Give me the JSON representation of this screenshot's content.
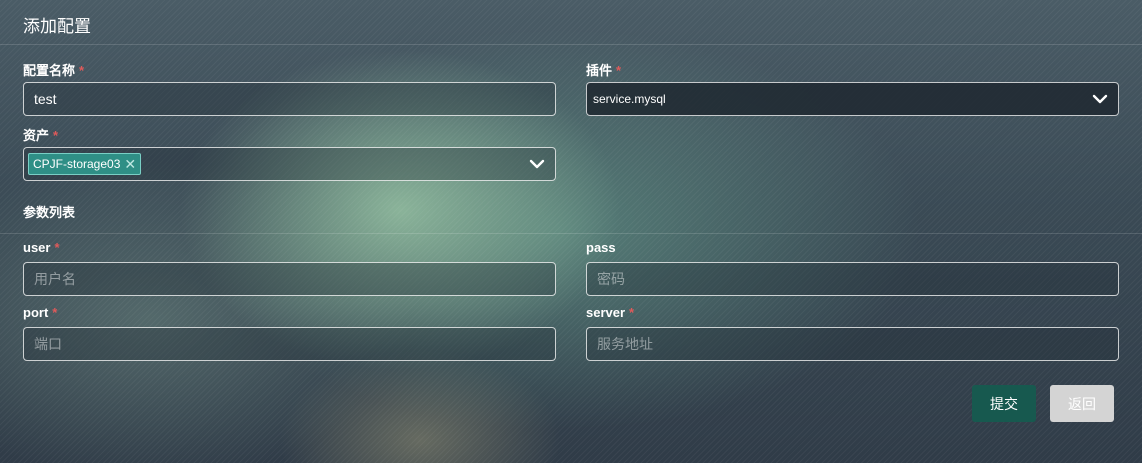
{
  "dialog": {
    "title": "添加配置"
  },
  "form": {
    "config_name": {
      "label": "配置名称",
      "required_mark": "*",
      "value": "test"
    },
    "plugin": {
      "label": "插件",
      "required_mark": "*",
      "selected": "service.mysql",
      "icon": "chevron-down-icon"
    },
    "asset": {
      "label": "资产",
      "required_mark": "*",
      "tags": [
        "CPJF-storage03"
      ],
      "tag_remove": "✕",
      "icon": "chevron-down-icon"
    }
  },
  "params": {
    "section_label": "参数列表",
    "user": {
      "label": "user",
      "required_mark": "*",
      "placeholder": "用户名"
    },
    "pass": {
      "label": "pass",
      "placeholder": "密码"
    },
    "port": {
      "label": "port",
      "required_mark": "*",
      "placeholder": "端口"
    },
    "server": {
      "label": "server",
      "required_mark": "*",
      "placeholder": "服务地址"
    }
  },
  "actions": {
    "submit_label": "提交",
    "back_label": "返回"
  },
  "colors": {
    "accent": "#17594f",
    "tag": "#2f8f86",
    "required": "#e05a5a",
    "back_button": "#d4d4d4"
  }
}
